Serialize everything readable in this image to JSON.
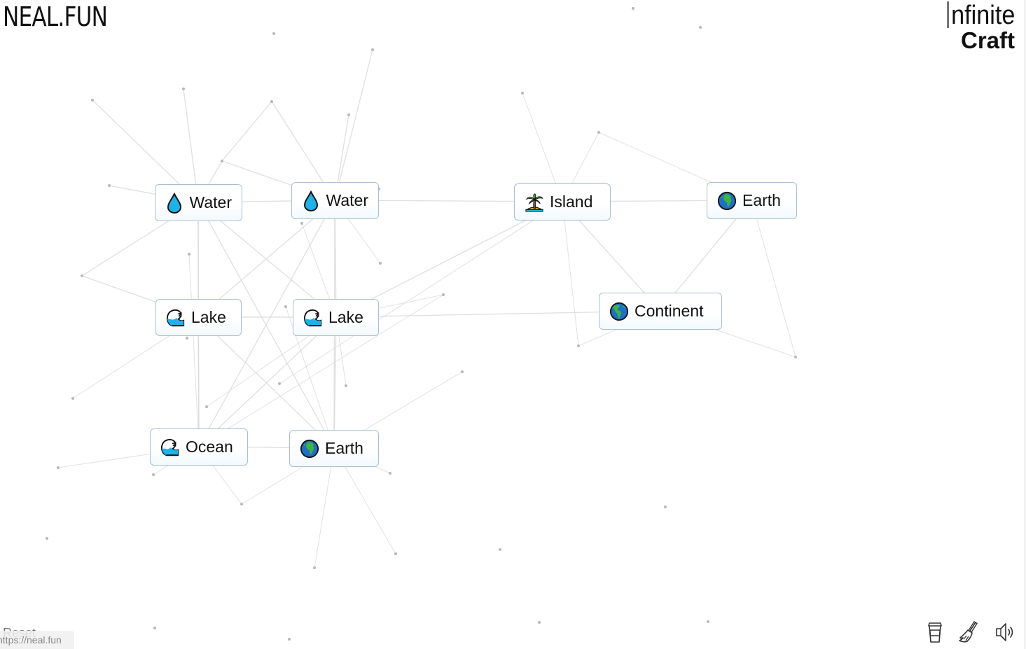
{
  "header": {
    "site_logo": "NEAL.FUN",
    "game_title_line1": "nfinite",
    "game_title_line2": "Craft"
  },
  "canvas": {
    "items": [
      {
        "label": "Water",
        "icon": "water-drop-icon"
      },
      {
        "label": "Water",
        "icon": "water-drop-icon"
      },
      {
        "label": "Island",
        "icon": "desert-island-icon"
      },
      {
        "label": "Earth",
        "icon": "globe-africa-icon"
      },
      {
        "label": "Lake",
        "icon": "water-wave-icon"
      },
      {
        "label": "Lake",
        "icon": "water-wave-icon"
      },
      {
        "label": "Continent",
        "icon": "globe-americas-icon"
      },
      {
        "label": "Ocean",
        "icon": "water-wave-icon"
      },
      {
        "label": "Earth",
        "icon": "globe-africa-icon"
      }
    ]
  },
  "footer": {
    "reset_label": "Reset",
    "status_url": "https://neal.fun",
    "tools": [
      {
        "name": "donate",
        "icon": "coffee-cup-icon"
      },
      {
        "name": "clear",
        "icon": "broom-icon"
      },
      {
        "name": "sound",
        "icon": "speaker-icon"
      }
    ]
  },
  "colors": {
    "item_border": "#a9bfd6",
    "line_color": "#d8d8d8",
    "dot_color": "#b8b8b8",
    "water_blue": "#1cb4e8",
    "globe_blue": "#1e6fc8",
    "globe_green": "#3cb53c"
  }
}
